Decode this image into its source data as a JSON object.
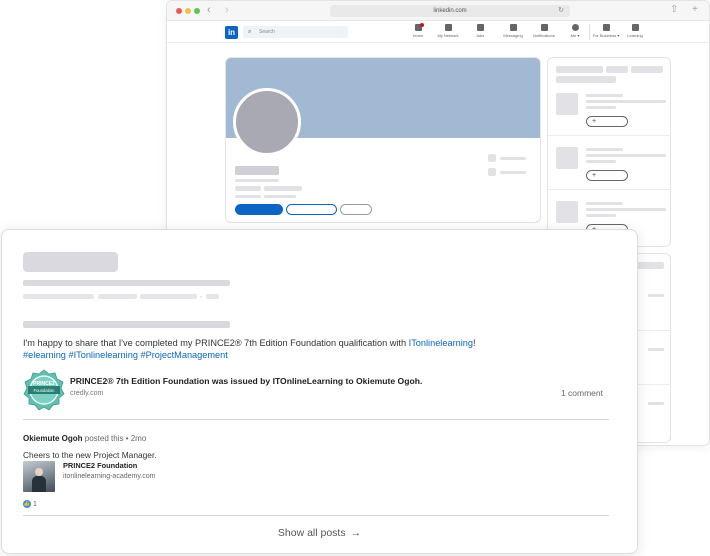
{
  "browser": {
    "url": "linkedin.com",
    "nav": [
      {
        "label": "Home",
        "badge": true
      },
      {
        "label": "My Network",
        "badge": false
      },
      {
        "label": "Jobs",
        "badge": false
      },
      {
        "label": "Messaging",
        "badge": false
      },
      {
        "label": "Notifications",
        "badge": false
      },
      {
        "label": "Me ▾",
        "badge": false
      },
      {
        "label": "For Business ▾",
        "badge": false
      },
      {
        "label": "Learning",
        "badge": false
      }
    ],
    "search_placeholder": "Search",
    "logo": "in"
  },
  "post": {
    "text_before": "I'm happy to share that I've completed my PRINCE2® 7th Edition Foundation qualification with ",
    "text_link": "ITonlinelearning",
    "text_after": "!",
    "hashtags": "#elearning #ITonlinelearning #ProjectManagement",
    "credential": {
      "badge_brand": "PRINCE2",
      "badge_line": "Foundation",
      "title": "PRINCE2® 7th Edition Foundation was issued by ITOnlineLearning to Okiemute Ogoh.",
      "source": "credly.com"
    },
    "comment_count": "1 comment",
    "comment": {
      "author": "Okiemute Ogoh",
      "meta": " posted this • 2mo",
      "text": "Cheers to the new Project Manager.",
      "link_title": "PRINCE2 Foundation",
      "link_source": "itonlinelearning-academy.com"
    },
    "likes": "1",
    "show_all": "Show all posts",
    "show_all_arrow": "→"
  },
  "side": {
    "follow_label": "+"
  },
  "colors": {
    "brand": "#0a66c2",
    "cover": "#a1b9d2",
    "badge": "#5fbfb0"
  }
}
